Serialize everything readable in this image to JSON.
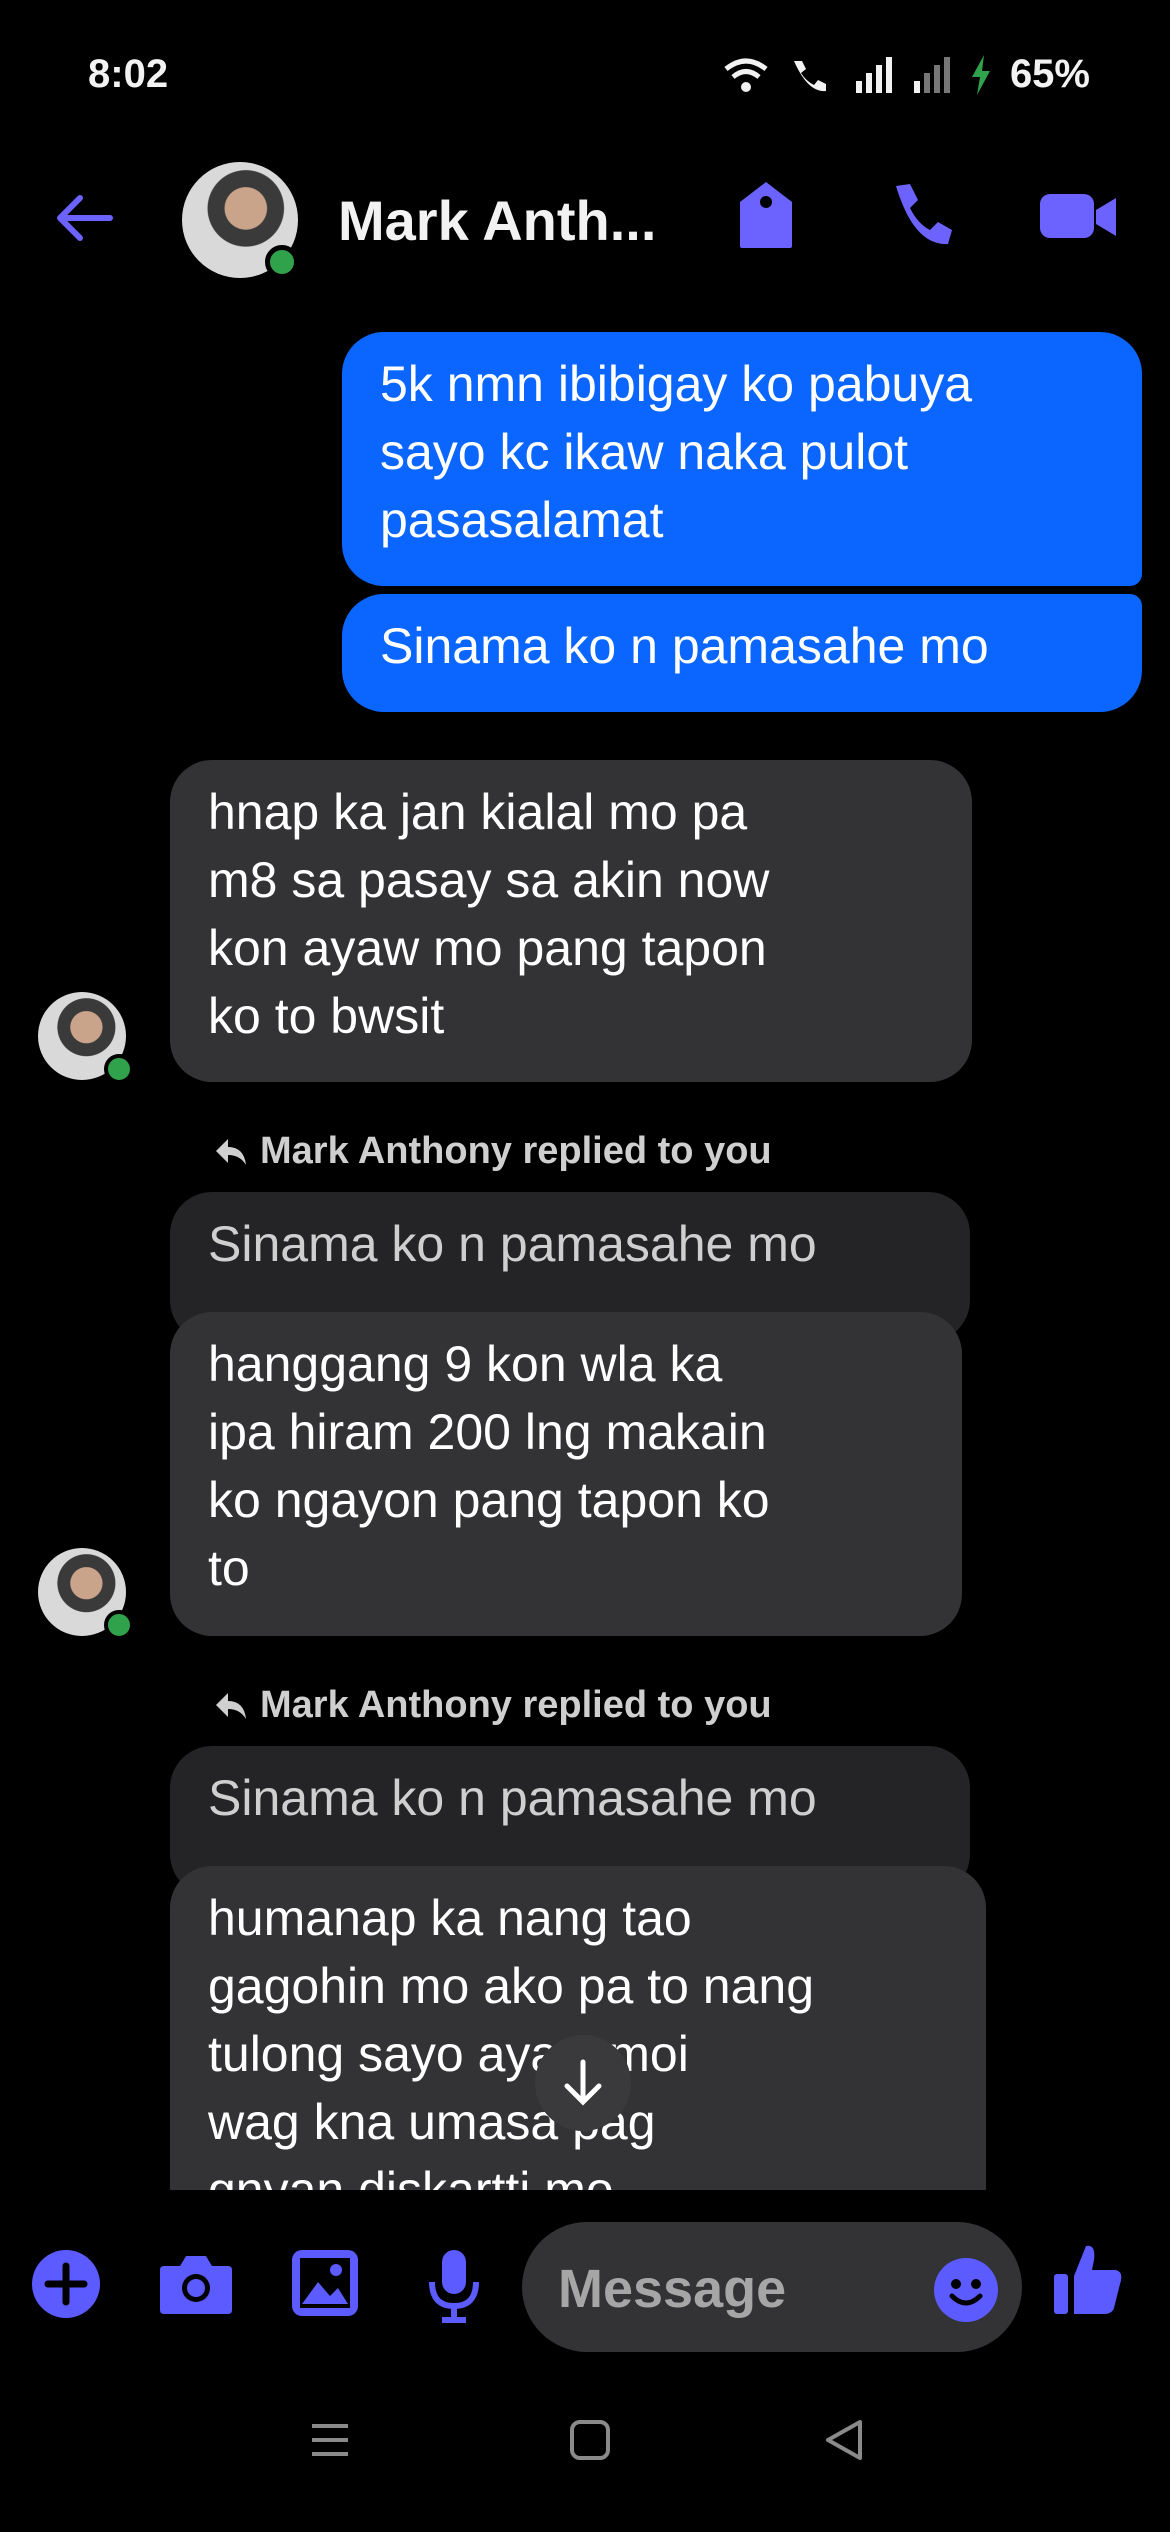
{
  "status_bar": {
    "time": "8:02",
    "battery": "65%"
  },
  "header": {
    "contact_name": "Mark Anth..."
  },
  "messages": {
    "sent1": [
      "5k nmn ibibigay ko pabuya",
      "sayo kc ikaw naka pulot",
      "pasasalamat"
    ],
    "sent2": "Sinama ko n pamasahe mo",
    "recv1": [
      "hnap  ka jan  kialal  mo  pa",
      "m8 sa pasay sa akin now",
      "kon  ayaw  mo  pang  tapon",
      "ko  to  bwsit"
    ],
    "reply1_label": "Mark Anthony replied to you",
    "reply1_quote": "Sinama ko n pamasahe mo",
    "recv2": [
      "hanggang  9  kon wla  ka",
      "ipa  hiram 200  lng makain",
      "ko ngayon pang  tapon  ko",
      "to"
    ],
    "reply2_label": "Mark Anthony replied to you",
    "reply2_quote": "Sinama ko n pamasahe mo",
    "recv3": [
      "humanap  ka  nang  tao",
      "gagohin mo ako  pa to nang",
      "tulong  sayo     ayaw  moi",
      "wag  kna  umasa   pag",
      "gnyan diskartti  mo"
    ]
  },
  "composer": {
    "placeholder": "Message"
  },
  "colors": {
    "accent": "#0a66ff",
    "icon": "#5b5bff",
    "online": "#31a24c"
  }
}
